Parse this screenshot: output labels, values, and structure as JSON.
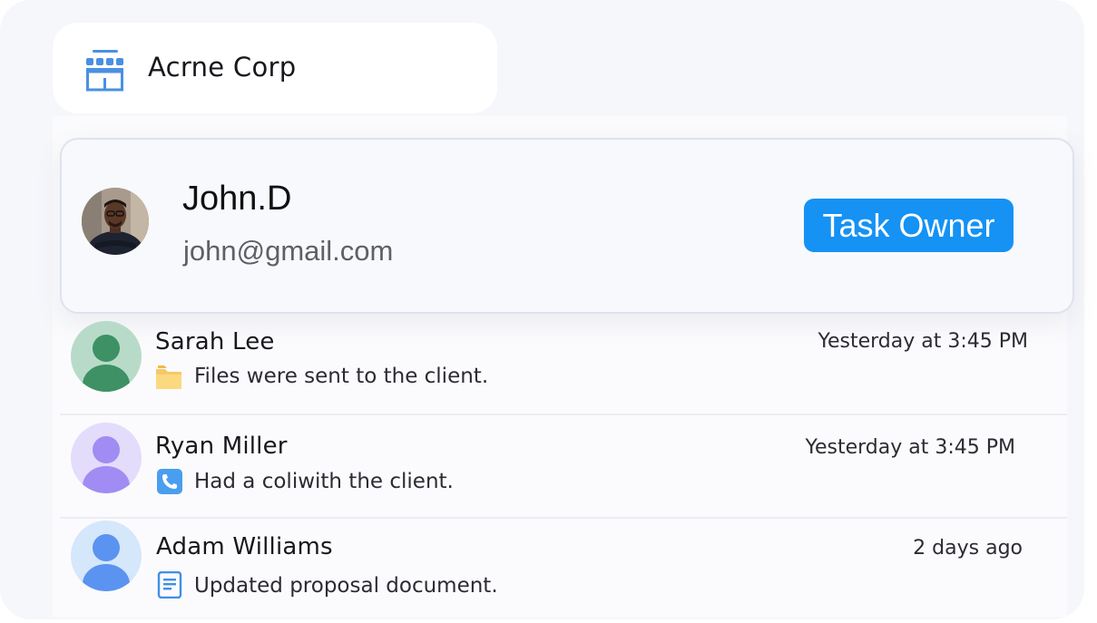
{
  "organization": {
    "name": "Acrne Corp",
    "icon": "storefront-icon",
    "icon_color": "#4a90e2"
  },
  "owner": {
    "name": "John.D",
    "email": "john@gmail.com",
    "role": "Task Owner",
    "role_color": "#1592f4"
  },
  "activity": [
    {
      "name": "Sarah Lee",
      "text": "Files were sent to the client.",
      "time": "Yesterday at 3:45 PM",
      "icon": "folder-icon",
      "avatar_bg": "#b8dbc9",
      "avatar_fg": "#3d9165"
    },
    {
      "name": "Ryan Miller",
      "text": "Had a coliwith the client.",
      "time": "Yesterday at 3:45 PM",
      "icon": "phone-icon",
      "avatar_bg": "#e3dcfb",
      "avatar_fg": "#a08cf3"
    },
    {
      "name": "Adam Williams",
      "text": "Updated proposal document.",
      "time": "2 days ago",
      "icon": "document-icon",
      "avatar_bg": "#d5e7fb",
      "avatar_fg": "#5b93f0"
    }
  ]
}
